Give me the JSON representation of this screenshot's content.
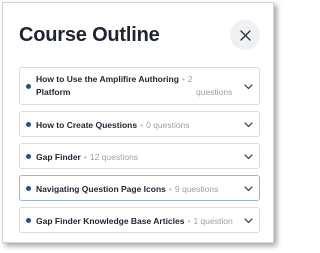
{
  "dialog": {
    "title": "Course Outline",
    "close_icon": "close-icon"
  },
  "items": [
    {
      "label_line1": "How to Use the Amplifire Authoring",
      "count_line1": "2",
      "label_line2": "Platform",
      "count_line2": "questions",
      "dot_color": "#2f4b80"
    },
    {
      "label": "How to Create Questions",
      "count": "0 questions",
      "dot_color": "#2f4b80"
    },
    {
      "label": "Gap Finder",
      "count": "12 questions",
      "dot_color": "#2f4b80"
    },
    {
      "label": "Navigating Question Page Icons",
      "count": "9 questions",
      "dot_color": "#2f4b80",
      "active": true
    },
    {
      "label": "Gap Finder Knowledge Base Articles",
      "count": "1 question",
      "dot_color": "#2f4b80"
    }
  ],
  "separator": "•",
  "chevron_icon": "chevron-down-icon",
  "colors": {
    "accent_dot": "#2f4b80",
    "title_text": "#1f2430",
    "muted_text": "#9aa0aa",
    "active_border": "#9fb3d1"
  }
}
